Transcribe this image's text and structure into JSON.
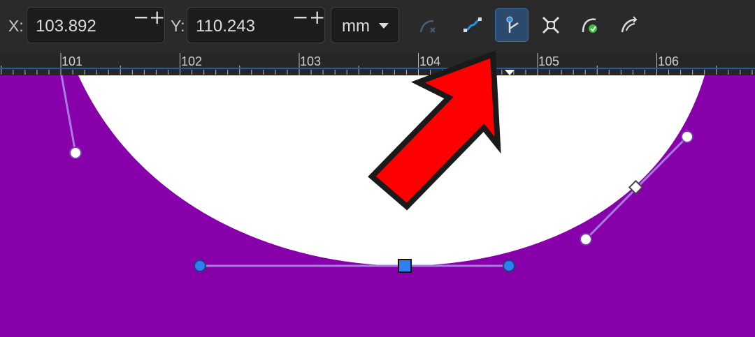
{
  "toolbar": {
    "x_label": "X:",
    "x_value": "103.892",
    "y_label": "Y:",
    "y_value": "110.243",
    "spin_minus": "−",
    "spin_plus": "+",
    "unit": "mm",
    "tools": [
      {
        "icon": "break-curve-icon",
        "state": "disabled"
      },
      {
        "icon": "convert-smooth-icon",
        "state": "normal"
      },
      {
        "icon": "convert-sharp-node-icon",
        "state": "active"
      },
      {
        "icon": "transform-node-icon",
        "state": "normal"
      },
      {
        "icon": "close-curve-icon",
        "state": "normal"
      },
      {
        "icon": "reverse-curve-icon",
        "state": "normal"
      }
    ]
  },
  "ruler": {
    "labels": [
      "101",
      "102",
      "103",
      "104",
      "105",
      "106"
    ]
  },
  "colors": {
    "canvas": "#8800a9",
    "shape_fill": "#ffffff",
    "handle_line": "#a77ce0",
    "selected_node": "#2f7ff0",
    "annotation_arrow": "#ff0000",
    "guide_line": "#1f5fa8"
  }
}
